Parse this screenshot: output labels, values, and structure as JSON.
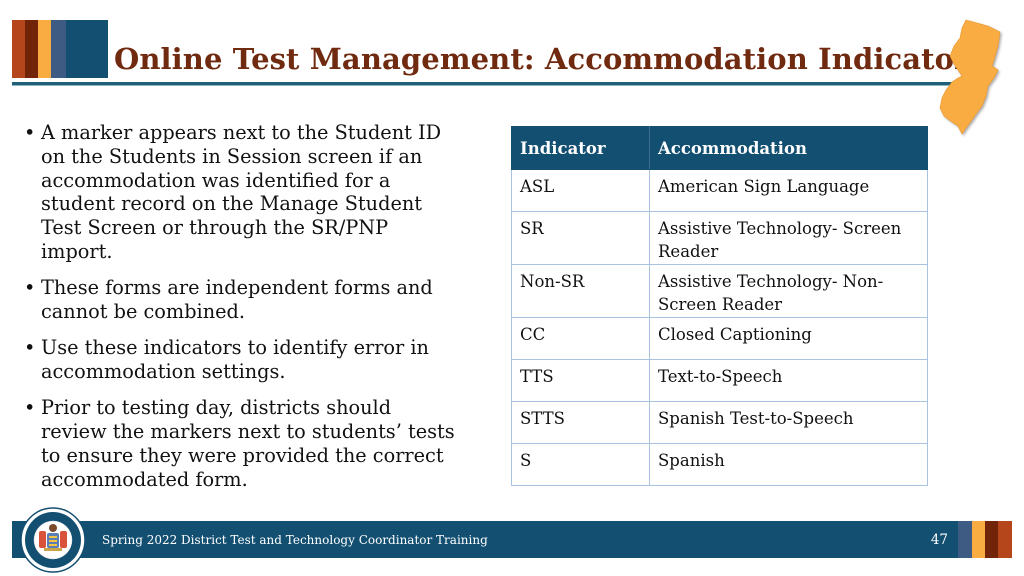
{
  "slide": {
    "title": "Online Test Management: Accommodation Indicators",
    "page_number": "47",
    "footer_text": "Spring 2022 District Test and Technology Coordinator Training"
  },
  "colors": {
    "title": "#6f2a0f",
    "navy": "#134f71",
    "slate": "#3e5c83",
    "amber": "#f9ac42",
    "brown": "#722409",
    "orange_red": "#b5461c",
    "table_border": "#a9c2e0"
  },
  "icons": {
    "state_map": "new-jersey-map-icon",
    "seal": "nj-department-of-education-seal-icon"
  },
  "bullets": [
    {
      "bullet": "•",
      "text": "A marker appears next to the Student ID on the Students in Session screen if an accommodation was identified for a student record on the Manage Student Test Screen or through the SR/PNP import."
    },
    {
      "bullet": "•",
      "text": "These forms are independent forms and cannot be combined."
    },
    {
      "bullet": "•",
      "text": "Use these indicators to identify error in accommodation settings."
    },
    {
      "bullet": "•",
      "text": "Prior to testing day, districts should review the markers next to students’ tests to ensure they were provided the correct accommodated form."
    }
  ],
  "table": {
    "headers": [
      "Indicator",
      "Accommodation"
    ],
    "rows": [
      {
        "indicator": "ASL",
        "accommodation": "American Sign Language"
      },
      {
        "indicator": "SR",
        "accommodation": "Assistive Technology- Screen Reader"
      },
      {
        "indicator": "Non-SR",
        "accommodation": "Assistive Technology- Non-Screen Reader"
      },
      {
        "indicator": "CC",
        "accommodation": "Closed Captioning"
      },
      {
        "indicator": "TTS",
        "accommodation": "Text-to-Speech"
      },
      {
        "indicator": "STTS",
        "accommodation": "Spanish Test-to-Speech"
      },
      {
        "indicator": "S",
        "accommodation": "Spanish"
      }
    ]
  }
}
